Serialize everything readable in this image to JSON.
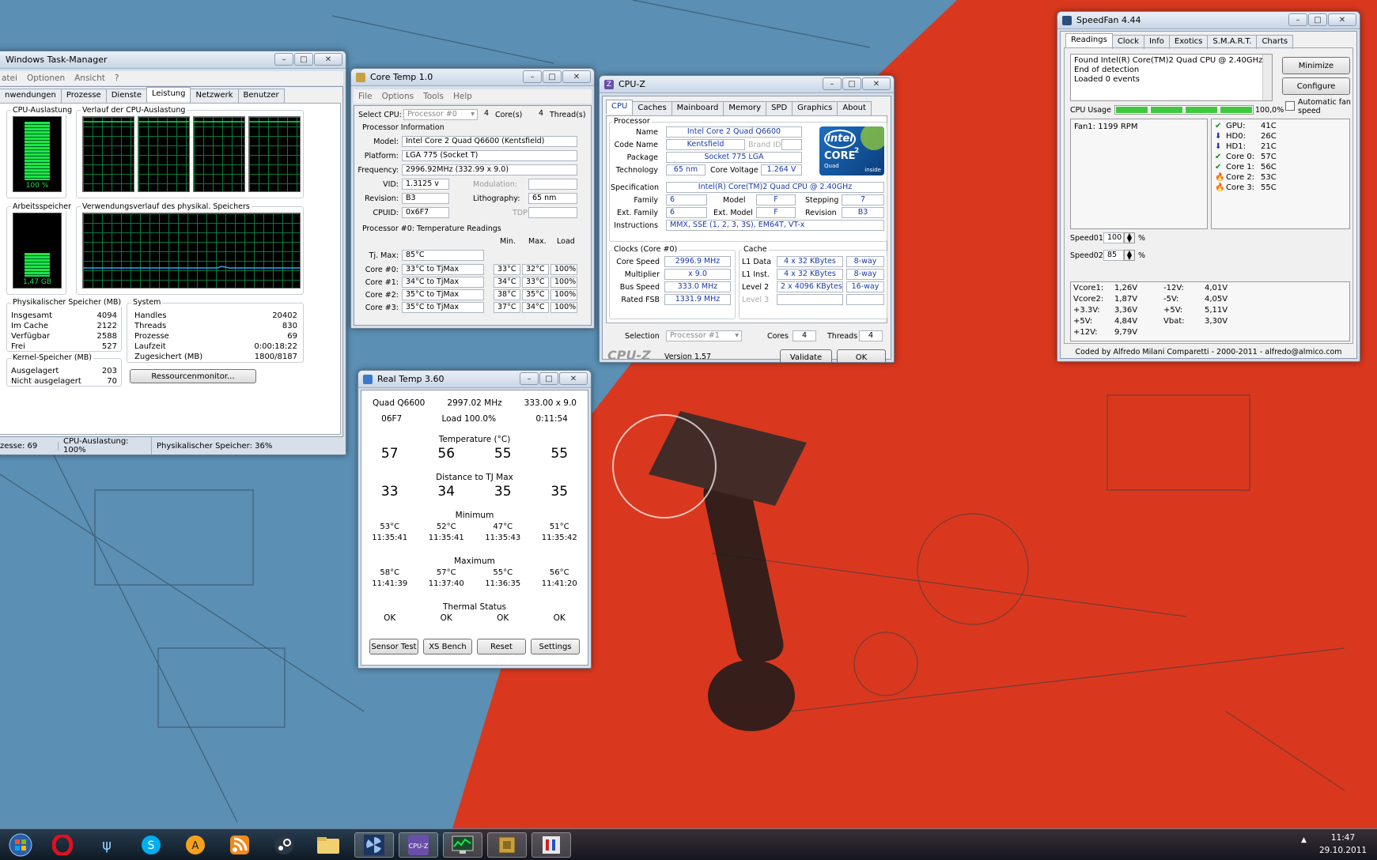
{
  "taskmgr": {
    "title": "Windows Task-Manager",
    "menu": [
      "atei",
      "Optionen",
      "Ansicht",
      "?"
    ],
    "tabs": [
      "nwendungen",
      "Prozesse",
      "Dienste",
      "Leistung",
      "Netzwerk",
      "Benutzer"
    ],
    "cpu_label": "CPU-Auslastung",
    "cpu_value": "100 %",
    "cpu_history_label": "Verlauf der CPU-Auslastung",
    "mem_label": "Arbeitsspeicher",
    "mem_value": "1,47 GB",
    "mem_history_label": "Verwendungsverlauf des physikal. Speichers",
    "phys_header": "Physikalischer Speicher (MB)",
    "phys": [
      [
        "Insgesamt",
        "4094"
      ],
      [
        "Im Cache",
        "2122"
      ],
      [
        "Verfügbar",
        "2588"
      ],
      [
        "Frei",
        "527"
      ]
    ],
    "kernel_header": "Kernel-Speicher (MB)",
    "kernel": [
      [
        "Ausgelagert",
        "203"
      ],
      [
        "Nicht ausgelagert",
        "70"
      ]
    ],
    "system_header": "System",
    "system": [
      [
        "Handles",
        "20402"
      ],
      [
        "Threads",
        "830"
      ],
      [
        "Prozesse",
        "69"
      ],
      [
        "Laufzeit",
        "0:00:18:22"
      ],
      [
        "Zugesichert (MB)",
        "1800/8187"
      ]
    ],
    "resmon_button": "Ressourcenmonitor...",
    "status": [
      "zesse: 69",
      "CPU-Auslastung: 100%",
      "Physikalischer Speicher: 36%"
    ]
  },
  "coretemp": {
    "title": "Core Temp 1.0",
    "menu": [
      "File",
      "Options",
      "Tools",
      "Help"
    ],
    "select_cpu_label": "Select CPU:",
    "select_cpu_value": "Processor #0",
    "cores_count": "4",
    "cores_label": "Core(s)",
    "threads_count": "4",
    "threads_label": "Thread(s)",
    "info_header": "Processor Information",
    "model_label": "Model:",
    "model": "Intel Core 2 Quad Q6600 (Kentsfield)",
    "platform_label": "Platform:",
    "platform": "LGA 775 (Socket T)",
    "freq_label": "Frequency:",
    "freq": "2996.92MHz (332.99 x 9.0)",
    "vid_label": "VID:",
    "vid": "1.3125 v",
    "modulation_label": "Modulation:",
    "revision_label": "Revision:",
    "revision": "B3",
    "litho_label": "Lithography:",
    "litho": "65 nm",
    "cpuid_label": "CPUID:",
    "cpuid": "0x6F7",
    "tdp_label": "TDP:",
    "temp_header": "Processor #0: Temperature Readings",
    "col_min": "Min.",
    "col_max": "Max.",
    "col_load": "Load",
    "tjmax_label": "Tj. Max:",
    "tjmax": "85°C",
    "cores": [
      {
        "label": "Core #0:",
        "val": "33°C to TjMax",
        "min": "33°C",
        "max": "32°C",
        "load": "100%"
      },
      {
        "label": "Core #1:",
        "val": "34°C to TjMax",
        "min": "34°C",
        "max": "33°C",
        "load": "100%"
      },
      {
        "label": "Core #2:",
        "val": "35°C to TjMax",
        "min": "38°C",
        "max": "35°C",
        "load": "100%"
      },
      {
        "label": "Core #3:",
        "val": "35°C to TjMax",
        "min": "37°C",
        "max": "34°C",
        "load": "100%"
      }
    ]
  },
  "cpuz": {
    "title": "CPU-Z",
    "tabs": [
      "CPU",
      "Caches",
      "Mainboard",
      "Memory",
      "SPD",
      "Graphics",
      "About"
    ],
    "processor_header": "Processor",
    "name_label": "Name",
    "name": "Intel Core 2 Quad Q6600",
    "codename_label": "Code Name",
    "codename": "Kentsfield",
    "brandid_label": "Brand ID",
    "package_label": "Package",
    "package": "Socket 775 LGA",
    "technology_label": "Technology",
    "technology": "65 nm",
    "corevoltage_label": "Core Voltage",
    "corevoltage": "1.264 V",
    "spec_label": "Specification",
    "spec": "Intel(R) Core(TM)2 Quad CPU      @ 2.40GHz",
    "family_label": "Family",
    "family": "6",
    "model_label": "Model",
    "model": "F",
    "stepping_label": "Stepping",
    "stepping": "7",
    "extfamily_label": "Ext. Family",
    "extfamily": "6",
    "extmodel_label": "Ext. Model",
    "extmodel": "F",
    "revision_label": "Revision",
    "revision": "B3",
    "instructions_label": "Instructions",
    "instructions": "MMX, SSE (1, 2, 3, 3S), EM64T, VT-x",
    "clocks_header": "Clocks (Core #0)",
    "corespeed_label": "Core Speed",
    "corespeed": "2996.9 MHz",
    "multiplier_label": "Multiplier",
    "multiplier": "x 9.0",
    "busspeed_label": "Bus Speed",
    "busspeed": "333.0 MHz",
    "ratedfsb_label": "Rated FSB",
    "ratedfsb": "1331.9 MHz",
    "cache_header": "Cache",
    "l1data_label": "L1 Data",
    "l1data": "4 x 32 KBytes",
    "l1data_way": "8-way",
    "l1inst_label": "L1 Inst.",
    "l1inst": "4 x 32 KBytes",
    "l1inst_way": "8-way",
    "l2_label": "Level 2",
    "l2": "2 x 4096 KBytes",
    "l2_way": "16-way",
    "l3_label": "Level 3",
    "selection_label": "Selection",
    "selection": "Processor #1",
    "cores_label": "Cores",
    "cores": "4",
    "threads_label": "Threads",
    "threads": "4",
    "logo_text": "CPU-Z",
    "version": "Version 1.57",
    "validate": "Validate",
    "ok": "OK",
    "intel_logo_lines": [
      "intel",
      "CORE",
      "2",
      "Quad",
      "inside"
    ]
  },
  "speedfan": {
    "title": "SpeedFan 4.44",
    "tabs": [
      "Readings",
      "Clock",
      "Info",
      "Exotics",
      "S.M.A.R.T.",
      "Charts"
    ],
    "log": [
      "Found Intel(R) Core(TM)2 Quad CPU @ 2.40GHz",
      "End of detection",
      "Loaded 0 events"
    ],
    "minimize": "Minimize",
    "configure": "Configure",
    "cpu_usage_label": "CPU Usage",
    "cpu_usage_value": "100,0%",
    "cpu_usage_fraction": 1.0,
    "auto_fan_label": "Automatic fan speed",
    "fan1": "Fan1: 1199 RPM",
    "temps": [
      {
        "label": "GPU:",
        "val": "41C",
        "icon": "check-icon"
      },
      {
        "label": "HD0:",
        "val": "26C",
        "icon": "down-arrow-icon"
      },
      {
        "label": "HD1:",
        "val": "21C",
        "icon": "down-arrow-icon"
      },
      {
        "label": "Core 0:",
        "val": "57C",
        "icon": "check-icon"
      },
      {
        "label": "Core 1:",
        "val": "56C",
        "icon": "check-icon"
      },
      {
        "label": "Core 2:",
        "val": "53C",
        "icon": "flame-icon"
      },
      {
        "label": "Core 3:",
        "val": "55C",
        "icon": "flame-icon"
      }
    ],
    "speed01_label": "Speed01:",
    "speed01": "100",
    "speed02_label": "Speed02:",
    "speed02": "85",
    "pct": "%",
    "volts_left": [
      [
        "Vcore1:",
        "1,26V"
      ],
      [
        "Vcore2:",
        "1,87V"
      ],
      [
        "+3.3V:",
        "3,36V"
      ],
      [
        "+5V:",
        "4,84V"
      ],
      [
        "+12V:",
        "9,79V"
      ]
    ],
    "volts_right": [
      [
        "-12V:",
        "4,01V"
      ],
      [
        "-5V:",
        "4,05V"
      ],
      [
        "+5V:",
        "5,11V"
      ],
      [
        "Vbat:",
        "3,30V"
      ]
    ],
    "footer": "Coded by Alfredo Milani Comparetti - 2000-2011 - alfredo@almico.com"
  },
  "realtemp": {
    "title": "Real Temp 3.60",
    "cpu": "Quad Q6600",
    "mhz": "2997.02 MHz",
    "mult": "333.00 x 9.0",
    "id": "06F7",
    "load": "Load 100.0%",
    "time": "0:11:54",
    "temp_header": "Temperature (°C)",
    "temps": [
      "57",
      "56",
      "55",
      "55"
    ],
    "dist_header": "Distance to TJ Max",
    "dists": [
      "33",
      "34",
      "35",
      "35"
    ],
    "min_header": "Minimum",
    "mins": [
      [
        "53°C",
        "11:35:41"
      ],
      [
        "52°C",
        "11:35:41"
      ],
      [
        "47°C",
        "11:35:43"
      ],
      [
        "51°C",
        "11:35:42"
      ]
    ],
    "max_header": "Maximum",
    "maxs": [
      [
        "58°C",
        "11:41:39"
      ],
      [
        "57°C",
        "11:37:40"
      ],
      [
        "55°C",
        "11:36:35"
      ],
      [
        "56°C",
        "11:41:20"
      ]
    ],
    "thermal_header": "Thermal Status",
    "status": [
      "OK",
      "OK",
      "OK",
      "OK"
    ],
    "buttons": [
      "Sensor Test",
      "XS Bench",
      "Reset",
      "Settings"
    ]
  },
  "taskbar": {
    "clock_time": "11:47",
    "clock_date": "29.10.2011",
    "icons": [
      "windows-orb-icon",
      "opera-icon",
      "psi-icon",
      "skype-icon",
      "avast-icon",
      "rss-icon",
      "steam-icon",
      "explorer-icon",
      "speedfan-icon",
      "cpuz-icon",
      "taskmgr-icon",
      "coretemp-icon",
      "realtemp-icon"
    ]
  },
  "colors": {
    "desktop_blue": "#5b8fb3",
    "desktop_red": "#d9381e",
    "graph_green": "#19e64a",
    "value_blue": "#1a3aa8"
  }
}
